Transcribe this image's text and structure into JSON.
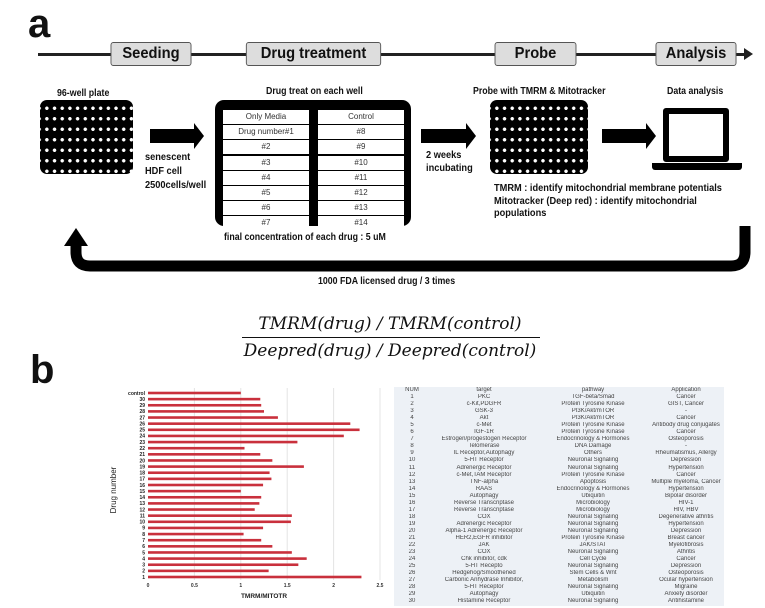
{
  "panel_a": {
    "label": "a",
    "stages": [
      "Seeding",
      "Drug treatment",
      "Probe",
      "Analysis"
    ],
    "plate1_title": "96-well plate",
    "seeding_note": [
      "senescent",
      "HDF cell",
      "2500cells/well"
    ],
    "treatment_title": "Drug treat on each well",
    "treatment_left": [
      "Only Media",
      "Drug number#1",
      "#2",
      "#3",
      "#4",
      "#5",
      "#6",
      "#7"
    ],
    "treatment_right": [
      "Control",
      "#8",
      "#9",
      "#10",
      "#11",
      "#12",
      "#13",
      "#14"
    ],
    "concentration_note": "final concentration of each drug : 5 uM",
    "incubation_note": [
      "2 weeks",
      "incubating"
    ],
    "probe_title": "Probe with TMRM & Mitotracker",
    "analysis_title": "Data analysis",
    "probe_notes": [
      "TMRM : identify mitochondrial membrane potentials",
      "Mitotracker (Deep red) : identify mitochondrial",
      "populations"
    ],
    "loop_note": "1000 FDA licensed drug / 3 times"
  },
  "formula": {
    "numerator": "TMRM(drug) / TMRM(control)",
    "denominator": "Deepred(drug) / Deepred(control)"
  },
  "panel_b": {
    "label": "b"
  },
  "chart_data": {
    "type": "bar",
    "orientation": "horizontal",
    "categories": [
      "1",
      "2",
      "3",
      "4",
      "5",
      "6",
      "7",
      "8",
      "9",
      "10",
      "11",
      "12",
      "13",
      "14",
      "15",
      "16",
      "17",
      "18",
      "19",
      "20",
      "21",
      "22",
      "23",
      "24",
      "25",
      "26",
      "27",
      "28",
      "29",
      "30",
      "control"
    ],
    "values": [
      2.3,
      1.3,
      1.62,
      1.71,
      1.55,
      1.34,
      1.22,
      1.03,
      1.24,
      1.54,
      1.55,
      1.15,
      1.2,
      1.22,
      1.0,
      1.24,
      1.33,
      1.31,
      1.68,
      1.34,
      1.21,
      1.04,
      1.61,
      2.11,
      2.28,
      2.18,
      1.4,
      1.25,
      1.22,
      1.21,
      1.0
    ],
    "xlabel": "TMRM/MITOTR",
    "ylabel": "Drug number",
    "xlim": [
      0,
      2.5
    ],
    "xticks": [
      "0",
      "0.5",
      "1",
      "1.5",
      "2",
      "2.5"
    ],
    "grid": "vertical",
    "bar_color": "#c9303c"
  },
  "table": {
    "headers": [
      "NUM",
      "target",
      "pathway",
      "Application"
    ],
    "rows": [
      [
        "1",
        "PKC",
        "TGF-beta/Smad",
        "Cancer"
      ],
      [
        "2",
        "c-Kit,PDGFR",
        "Protein Tyrosine Kinase",
        "GIST, Cancer"
      ],
      [
        "3",
        "GSK-3",
        "PI3K/Akt/mTOR",
        "-"
      ],
      [
        "4",
        "Akt",
        "PI3K/Akt/mTOR",
        "Cancer"
      ],
      [
        "5",
        "c-Met",
        "Protein Tyrosine Kinase",
        "Antibody drug conjugates"
      ],
      [
        "6",
        "IGF-1R",
        "Protein Tyrosine Kinase",
        "Cancer"
      ],
      [
        "7",
        "Estrogen/progestogen Receptor",
        "Endocrinology & Hormones",
        "Osteoporosis"
      ],
      [
        "8",
        "Telomerase",
        "DNA Damage",
        "-"
      ],
      [
        "9",
        "IL Receptor,Autophagy",
        "Others",
        "Rheumatismus, Allergy"
      ],
      [
        "10",
        "5-HT Receptor",
        "Neuronal Signaling",
        "Depression"
      ],
      [
        "11",
        "Adrenergic Receptor",
        "Neuronal Signaling",
        "Hypertension"
      ],
      [
        "12",
        "c-Met,TAM Receptor",
        "Protein Tyrosine Kinase",
        "Cancer"
      ],
      [
        "13",
        "TNF-alpha",
        "Apoptosis",
        "Multiple myeloma, Cancer"
      ],
      [
        "14",
        "RAAS",
        "Endocrinology & Hormones",
        "Hypertension"
      ],
      [
        "15",
        "Autophagy",
        "Ubiquitin",
        "Bipolar disorder"
      ],
      [
        "16",
        "Reverse Transcriptase",
        "Microbiology",
        "HIV-1"
      ],
      [
        "17",
        "Reverse Transcriptase",
        "Microbiology",
        "HIV, HBV"
      ],
      [
        "18",
        "COX",
        "Neuronal Signaling",
        "Degenerative athritis"
      ],
      [
        "19",
        "Adrenergic Receptor",
        "Neuronal Signaling",
        "Hypertension"
      ],
      [
        "20",
        "Alpha-1 Adrenergic Receptor",
        "Neuronal Signaling",
        "Depression"
      ],
      [
        "21",
        "HER2,EGFR inhibitor",
        "Protein Tyrosine Kinase",
        "Breast cancer"
      ],
      [
        "22",
        "JAK",
        "JAK/STAT",
        "Myelofibrosis"
      ],
      [
        "23",
        "COX",
        "Neuronal Signaling",
        "Athritis"
      ],
      [
        "24",
        "Chk inhibitor, cdk",
        "Cell Cycle",
        "Cancer"
      ],
      [
        "25",
        "5-HT Recepto",
        "Neuronal Signaling",
        "Depression"
      ],
      [
        "26",
        "Hedgehog/Smoothened",
        "Stem Cells & Wnt",
        "Osteoporosis"
      ],
      [
        "27",
        "Carbonic Anhydrase Inhibitor,",
        "Metabolism",
        "Ocular hypertension"
      ],
      [
        "28",
        "5-HT Receptor",
        "Neuronal Signaling",
        "Migraine"
      ],
      [
        "29",
        "Autophagy",
        "Ubiquitin",
        "Anxiety disorder"
      ],
      [
        "30",
        "Histamine Receptor",
        "Neuronal Signaling",
        "Antihistamine"
      ]
    ]
  }
}
